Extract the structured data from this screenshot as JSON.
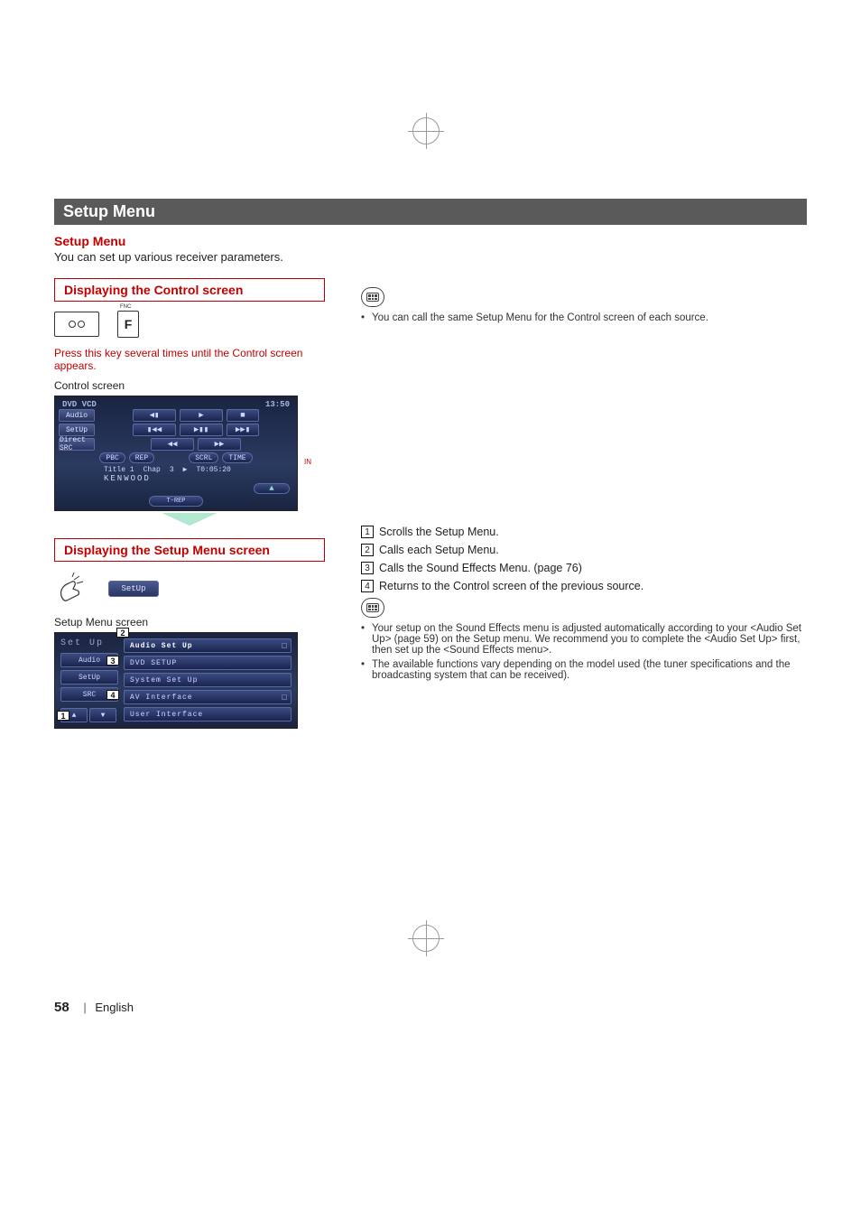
{
  "sectionBar": "Setup Menu",
  "subheading": "Setup Menu",
  "intro": "You can set up various receiver parameters.",
  "panels": {
    "control": {
      "title": "Displaying the Control screen",
      "fncLabel": "FNC",
      "fKey": "F",
      "instruction": "Press this key several times until the Control screen appears.",
      "screenLabel": "Control screen",
      "screen": {
        "source": "DVD VCD",
        "clock": "13:50",
        "side": [
          "Audio",
          "SetUp",
          "Direct SRC"
        ],
        "row1": [
          "◀▮",
          "▶",
          "■"
        ],
        "row2": [
          "▮◀◀",
          "▶▮▮",
          "▶▶▮"
        ],
        "row3": [
          "◀◀",
          "▶▶"
        ],
        "pills": [
          "PBC",
          "REP",
          "SCRL",
          "TIME"
        ],
        "info": {
          "title": "Title 1",
          "chap": "Chap",
          "num": "3",
          "play": "▶",
          "time": "T0:05:20"
        },
        "brand": "KENWOOD",
        "eject": "▲",
        "inLabel": "IN",
        "trep": "T-REP"
      }
    },
    "setup": {
      "title": "Displaying the Setup Menu screen",
      "chip": "SetUp",
      "screenLabel": "Setup Menu screen",
      "screen": {
        "header": "Set Up",
        "left": {
          "audio": "Audio",
          "setup": "SetUp",
          "src": "SRC"
        },
        "rows": [
          "Audio Set Up",
          "DVD SETUP",
          "System Set Up",
          "AV Interface",
          "User Interface"
        ],
        "callouts": {
          "sidebarAudio": "3",
          "sidebarSrc": "4",
          "scroll": "1",
          "rowsHeader": "2"
        }
      }
    }
  },
  "right": {
    "topNotes": [
      "You can call the same Setup Menu for the Control screen of each source."
    ],
    "numbered": [
      {
        "n": "1",
        "t": "Scrolls the Setup Menu."
      },
      {
        "n": "2",
        "t": "Calls each Setup Menu."
      },
      {
        "n": "3",
        "t": "Calls the Sound Effects Menu. (page 76)"
      },
      {
        "n": "4",
        "t": "Returns to the Control screen of the previous source."
      }
    ],
    "bottomNotes": [
      "Your setup on the Sound Effects menu is adjusted automatically according to your <Audio Set Up> (page 59) on the Setup menu. We recommend you to complete the <Audio Set Up> first, then set up the <Sound Effects menu>.",
      "The available functions vary depending on the model used (the tuner specifications and the broadcasting system that can be received)."
    ]
  },
  "footer": {
    "page": "58",
    "lang": "English"
  }
}
